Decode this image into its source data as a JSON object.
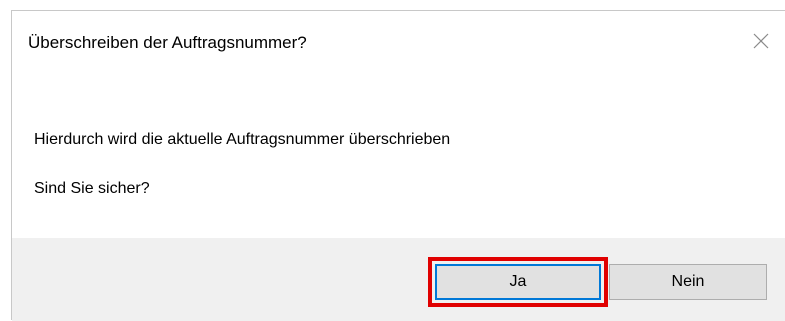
{
  "dialog": {
    "title": "Überschreiben der Auftragsnummer?",
    "close_icon": "close-icon",
    "message_lines": [
      "Hierdurch wird die aktuelle Auftragsnummer überschrieben",
      "Sind Sie sicher?"
    ],
    "buttons": {
      "yes_label": "Ja",
      "no_label": "Nein"
    },
    "highlight_color": "#e00000",
    "focus_color": "#0078d7"
  }
}
